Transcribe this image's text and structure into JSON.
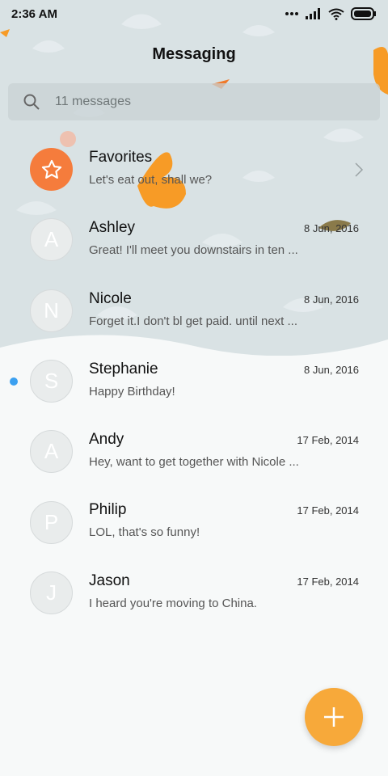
{
  "status_bar": {
    "time": "2:36 AM"
  },
  "header": {
    "title": "Messaging"
  },
  "search": {
    "placeholder": "11 messages"
  },
  "conversations": [
    {
      "name": "Favorites",
      "preview": "Let's eat out, shall we?",
      "date": "",
      "avatar": "star-icon",
      "unread": false
    },
    {
      "name": "Ashley",
      "preview": "Great! I'll meet you downstairs in ten ...",
      "date": "8 Jun, 2016",
      "avatar": "A",
      "unread": false
    },
    {
      "name": "Nicole",
      "preview": "Forget it.I don't bl get paid. until next ...",
      "date": "8 Jun, 2016",
      "avatar": "N",
      "unread": false
    },
    {
      "name": "Stephanie",
      "preview": "Happy Birthday!",
      "date": "8 Jun, 2016",
      "avatar": "S",
      "unread": true
    },
    {
      "name": "Andy",
      "preview": "Hey, want to get together with Nicole ...",
      "date": "17 Feb, 2014",
      "avatar": "A",
      "unread": false
    },
    {
      "name": "Philip",
      "preview": "LOL, that's so funny!",
      "date": "17 Feb, 2014",
      "avatar": "P",
      "unread": false
    },
    {
      "name": "Jason",
      "preview": "I heard you're moving to China.",
      "date": "17 Feb, 2014",
      "avatar": "J",
      "unread": false
    }
  ],
  "colors": {
    "accent_orange": "#f57c3c",
    "fab": "#f7a93a",
    "unread_dot": "#3ba0f0"
  }
}
